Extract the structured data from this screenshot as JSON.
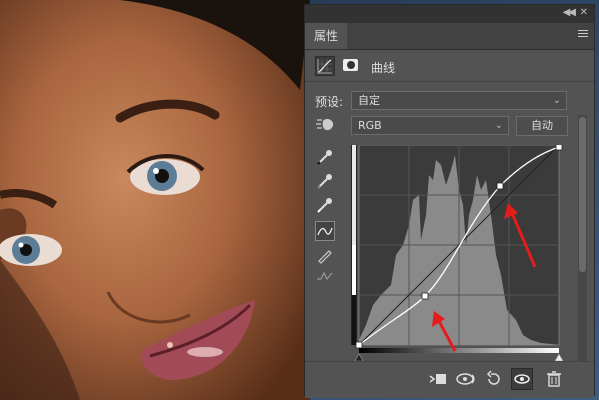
{
  "panel": {
    "tab_label": "属性",
    "adjustment_label": "曲线",
    "preset_label": "预设:",
    "preset_value": "自定",
    "channel_value": "RGB",
    "auto_button": "自动"
  },
  "icons": {
    "collapse": "double-chevron-icon",
    "close": "close-icon",
    "menu": "hamburger-menu-icon",
    "curves_adjustment": "curves-icon",
    "mask": "mask-icon",
    "on_image_adjust": "hand-target-icon",
    "sample_black": "eyedropper-black-icon",
    "sample_gray": "eyedropper-gray-icon",
    "sample_white": "eyedropper-white-icon",
    "edit_points": "curve-points-icon",
    "draw_curve": "pencil-icon",
    "smooth": "smooth-curve-icon",
    "clip_to_layer": "clip-layer-icon",
    "view_previous": "view-previous-icon",
    "reset": "reset-icon",
    "visibility": "eye-icon",
    "delete": "trash-icon"
  },
  "colors": {
    "panel_bg": "#535353",
    "annotation_arrow": "#e51c1c"
  }
}
